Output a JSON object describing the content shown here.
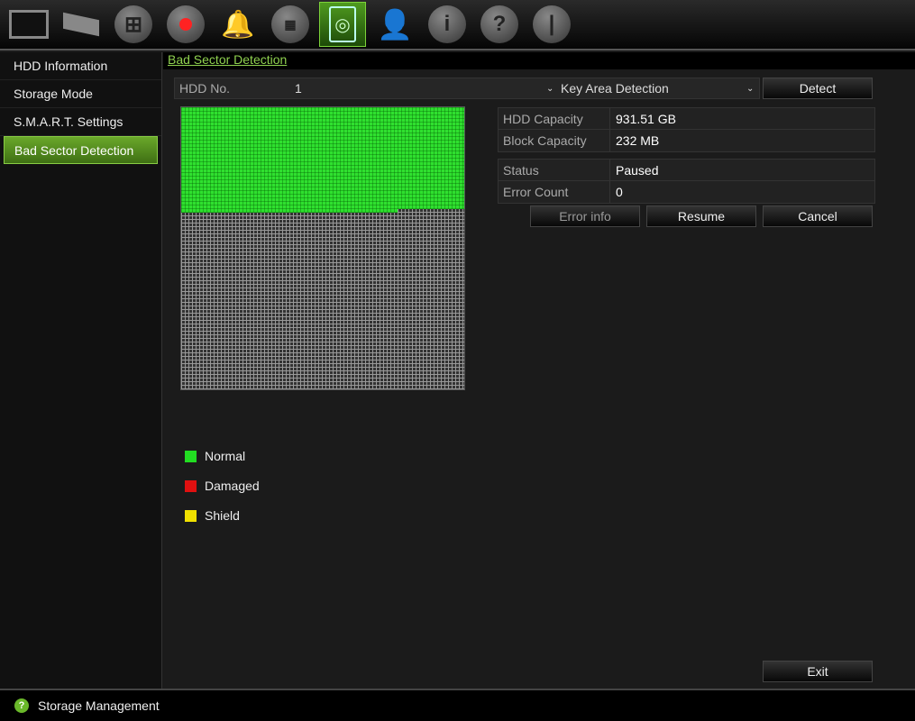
{
  "toolbar": {
    "icons": [
      "monitor-icon",
      "camera-icon",
      "network-icon",
      "record-icon",
      "alarm-icon",
      "device-icon",
      "hdd-icon",
      "user-icon",
      "info-icon",
      "help-icon",
      "power-icon"
    ],
    "active": "hdd-icon"
  },
  "sidebar": {
    "items": [
      {
        "label": "HDD Information"
      },
      {
        "label": "Storage Mode"
      },
      {
        "label": "S.M.A.R.T. Settings"
      },
      {
        "label": "Bad Sector Detection",
        "selected": true
      }
    ]
  },
  "main": {
    "title": "Bad Sector Detection",
    "hdd_label": "HDD No.",
    "hdd_value": "1",
    "mode_value": "Key Area Detection",
    "detect": "Detect",
    "info": [
      {
        "k": "HDD Capacity",
        "v": "931.51 GB"
      },
      {
        "k": "Block Capacity",
        "v": "232 MB"
      }
    ],
    "status": [
      {
        "k": "Status",
        "v": "Paused"
      },
      {
        "k": "Error Count",
        "v": "0"
      }
    ],
    "buttons": {
      "error_info": "Error info",
      "resume": "Resume",
      "cancel": "Cancel",
      "exit": "Exit"
    },
    "progress_fraction": 0.37,
    "legend": [
      {
        "label": "Normal",
        "color": "#22dd22"
      },
      {
        "label": "Damaged",
        "color": "#e01010"
      },
      {
        "label": "Shield",
        "color": "#f0e000"
      }
    ]
  },
  "footer": {
    "text": "Storage Management"
  },
  "colors": {
    "accent": "#6ab82a",
    "normal": "#2fe02f"
  }
}
